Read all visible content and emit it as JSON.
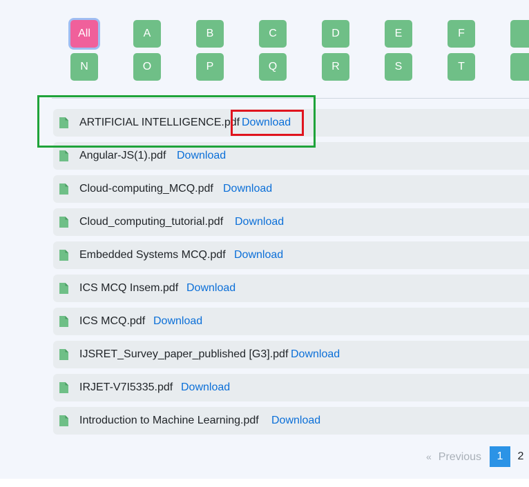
{
  "letter_filter": {
    "active": "All",
    "row1": [
      "All",
      "A",
      "B",
      "C",
      "D",
      "E",
      "F"
    ],
    "row2": [
      "N",
      "O",
      "P",
      "Q",
      "R",
      "S",
      "T"
    ]
  },
  "files": [
    {
      "name": "ARTIFICIAL INTELLIGENCE.pdf",
      "action": "Download"
    },
    {
      "name": "Angular-JS(1).pdf",
      "action": "Download"
    },
    {
      "name": "Cloud-computing_MCQ.pdf",
      "action": "Download"
    },
    {
      "name": "Cloud_computing_tutorial.pdf",
      "action": "Download"
    },
    {
      "name": "Embedded Systems MCQ.pdf",
      "action": "Download"
    },
    {
      "name": "ICS MCQ Insem.pdf",
      "action": "Download"
    },
    {
      "name": "ICS MCQ.pdf",
      "action": "Download"
    },
    {
      "name": "IJSRET_Survey_paper_published [G3].pdf",
      "action": "Download"
    },
    {
      "name": "IRJET-V7I5335.pdf",
      "action": "Download"
    },
    {
      "name": "Introduction to Machine Learning.pdf",
      "action": "Download"
    }
  ],
  "pagination": {
    "prev_chevron": "«",
    "prev_label": "Previous",
    "pages": [
      "1",
      "2"
    ],
    "current": "1"
  },
  "colors": {
    "letter_button": "#6fbf87",
    "letter_button_active": "#f0609b",
    "link": "#0b6fd8",
    "file_icon": "#6fbf87",
    "highlight_green": "#1fa33a",
    "highlight_red": "#e0141e",
    "page_current": "#2b93e6"
  },
  "icons": {
    "file": "file-icon"
  }
}
